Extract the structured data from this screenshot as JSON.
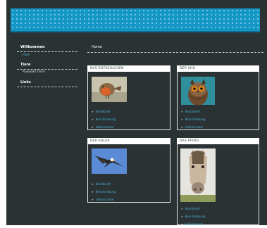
{
  "nav": {
    "items": [
      {
        "label": "Willkommen",
        "sub": [
          {
            "label": "Idee"
          }
        ]
      },
      {
        "label": "Tiere",
        "sub": [
          {
            "label": "Auswahl Tiere"
          }
        ]
      },
      {
        "label": "Links",
        "sub": []
      }
    ]
  },
  "main": {
    "title": "Home",
    "cards": [
      {
        "title": "DAS ROTKEHLCHEN",
        "image": "robin-photo",
        "links": [
          "Steckbrief",
          "Beschreibung",
          "Lebensraum"
        ]
      },
      {
        "title": "DER UHU",
        "image": "eagle-owl-photo",
        "links": [
          "Steckbrief",
          "Beschreibung",
          "Lebensraum"
        ]
      },
      {
        "title": "DER ADLER",
        "image": "eagle-photo",
        "links": [
          "Steckbrief",
          "Beschreibung",
          "Lebensraum"
        ]
      },
      {
        "title": "DAS PFERD",
        "image": "horse-photo",
        "links": [
          "Steckbrief",
          "Beschreibung",
          "Lebensraum"
        ]
      }
    ]
  },
  "colors": {
    "background": "#2b3233",
    "accent": "#1597c5",
    "link": "#48b0d6"
  }
}
